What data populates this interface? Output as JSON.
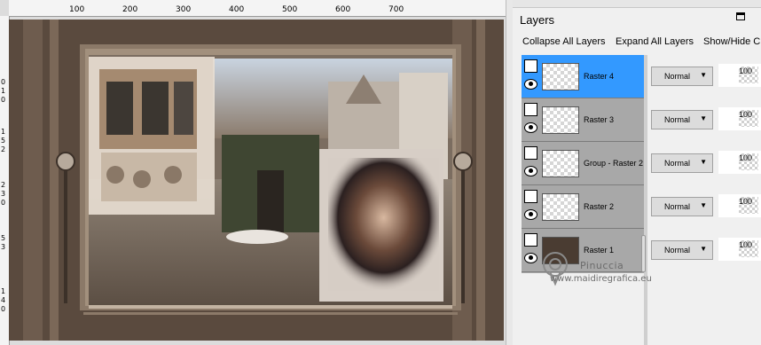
{
  "panel": {
    "title": "Layers",
    "menu_icon": "panel-menu-icon",
    "more_label": "",
    "toolbar": {
      "collapse": "Collapse All Layers",
      "expand": "Expand All Layers",
      "show_hide": "Show/Hide C"
    }
  },
  "layers": [
    {
      "name": "Raster 4",
      "blend": "Normal",
      "opacity": "100",
      "selected": true
    },
    {
      "name": "Raster 3",
      "blend": "Normal",
      "opacity": "100",
      "selected": false
    },
    {
      "name": "Group - Raster 2",
      "blend": "Normal",
      "opacity": "100",
      "selected": false
    },
    {
      "name": "Raster 2",
      "blend": "Normal",
      "opacity": "100",
      "selected": false
    },
    {
      "name": "Raster 1",
      "blend": "Normal",
      "opacity": "100",
      "selected": false
    }
  ],
  "ruler": {
    "top": [
      "100",
      "200",
      "300",
      "400",
      "500",
      "600",
      "700"
    ],
    "left": [
      "0",
      "1",
      "0",
      "1",
      "5",
      "2",
      "2",
      "3",
      "0",
      "5",
      "3",
      "1",
      "4",
      "0"
    ]
  },
  "watermark": {
    "line1": "Pinuccia",
    "line2": "www.maidiregrafica.eu"
  },
  "colors": {
    "selected": "#3399ff",
    "layer_bg": "#a8a8a8",
    "image_brown": "#5a4a3e"
  }
}
